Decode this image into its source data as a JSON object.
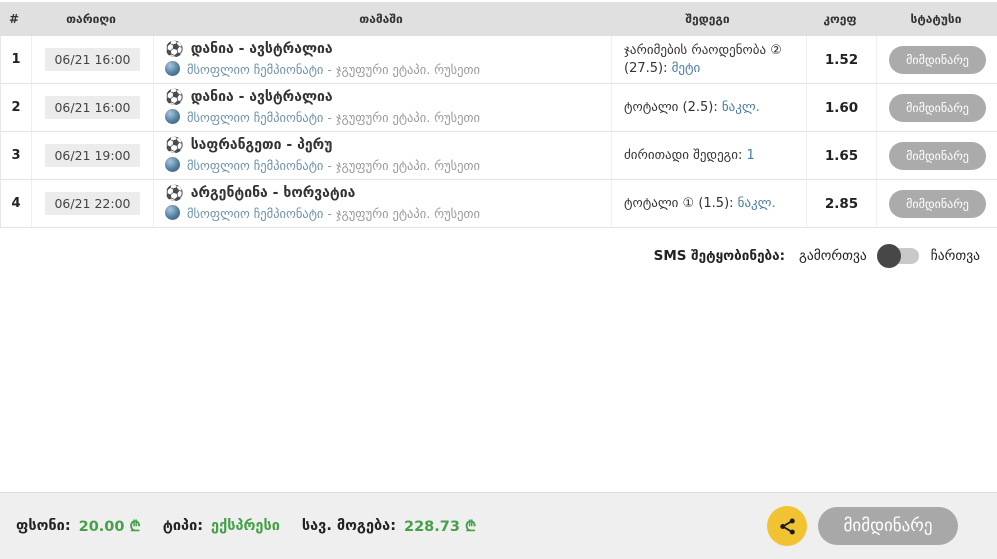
{
  "icons": {
    "ball": "⚽"
  },
  "colors": {
    "accent_green": "#45a049",
    "link_blue": "#4a7aa5",
    "league_blue": "#6d91a8",
    "share_yellow": "#f1c232",
    "status_gray": "#ababab"
  },
  "table": {
    "headers": {
      "num": "#",
      "date": "თარიღი",
      "game": "თამაში",
      "result": "შედეგი",
      "coef": "კოეფ",
      "status": "სტატუსი"
    },
    "rows": [
      {
        "num": "1",
        "date": "06/21 16:00",
        "teams": "დანია - ავსტრალია",
        "league": "მსოფლიო ჩემპიონატი",
        "league_suffix": " - ჯგუფური ეტაპი. რუსეთი",
        "result_prefix": "ჯარიმების რაოდენობა ② (27.5): ",
        "result_link": "მეტი",
        "coef": "1.52",
        "status": "მიმდინარე"
      },
      {
        "num": "2",
        "date": "06/21 16:00",
        "teams": "დანია - ავსტრალია",
        "league": "მსოფლიო ჩემპიონატი",
        "league_suffix": " - ჯგუფური ეტაპი. რუსეთი",
        "result_prefix": "ტოტალი (2.5): ",
        "result_link": "ნაკლ.",
        "coef": "1.60",
        "status": "მიმდინარე"
      },
      {
        "num": "3",
        "date": "06/21 19:00",
        "teams": "საფრანგეთი - პერუ",
        "league": "მსოფლიო ჩემპიონატი",
        "league_suffix": " - ჯგუფური ეტაპი. რუსეთი",
        "result_prefix": "ძირითადი შედეგი: ",
        "result_link": "1",
        "coef": "1.65",
        "status": "მიმდინარე"
      },
      {
        "num": "4",
        "date": "06/21 22:00",
        "teams": "არგენტინა - ხორვატია",
        "league": "მსოფლიო ჩემპიონატი",
        "league_suffix": " - ჯგუფური ეტაპი. რუსეთი",
        "result_prefix": "ტოტალი ① (1.5): ",
        "result_link": "ნაკლ.",
        "coef": "2.85",
        "status": "მიმდინარე"
      }
    ]
  },
  "sms": {
    "label": "SMS შეტყობინება:",
    "off_label": "გამორთვა",
    "on_label": "ჩართვა",
    "state": "off"
  },
  "footer": {
    "stake_label": "ფსონი:",
    "stake_value": "20.00 ₾",
    "type_label": "ტიპი:",
    "type_value": "ექსპრესი",
    "win_label": "სავ. მოგება:",
    "win_value": "228.73 ₾",
    "submit_label": "მიმდინარე"
  }
}
